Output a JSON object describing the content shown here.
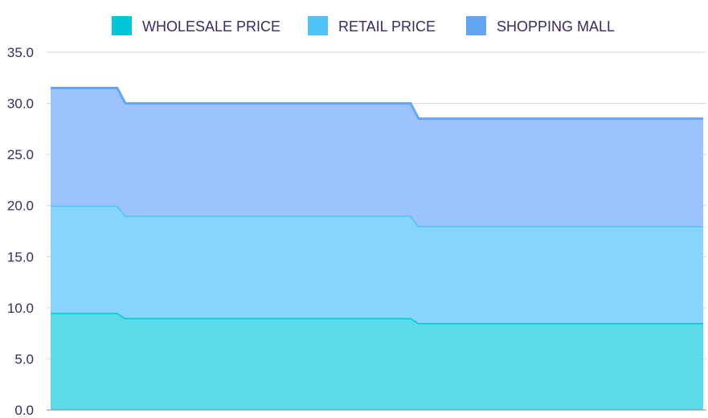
{
  "chart_data": {
    "type": "area",
    "stacked": true,
    "x": [
      0,
      1,
      2,
      3,
      4,
      5,
      6,
      7,
      8
    ],
    "series": [
      {
        "name": "WHOLESALE PRICE",
        "color": "#5bdbe8",
        "line_color": "#00c6d7",
        "values": [
          9.5,
          9.5,
          9.0,
          9.0,
          9.0,
          9.0,
          8.5,
          8.5,
          8.5
        ]
      },
      {
        "name": "RETAIL PRICE",
        "color": "#86d5fa",
        "line_color": "#4fc3f7",
        "values": [
          10.5,
          10.5,
          10.0,
          10.0,
          10.0,
          10.0,
          9.5,
          9.5,
          9.5
        ]
      },
      {
        "name": "SHOPPING MALL",
        "color": "#9cc3fb",
        "line_color": "#64a6f4",
        "values": [
          11.5,
          11.5,
          11.0,
          11.0,
          11.0,
          11.0,
          10.5,
          10.5,
          10.5
        ]
      }
    ],
    "y_ticks": [
      "0.0",
      "5.0",
      "10.0",
      "15.0",
      "20.0",
      "25.0",
      "30.0",
      "35.0"
    ],
    "ylim": [
      0,
      35
    ],
    "grid": true,
    "legend_position": "top-center"
  }
}
